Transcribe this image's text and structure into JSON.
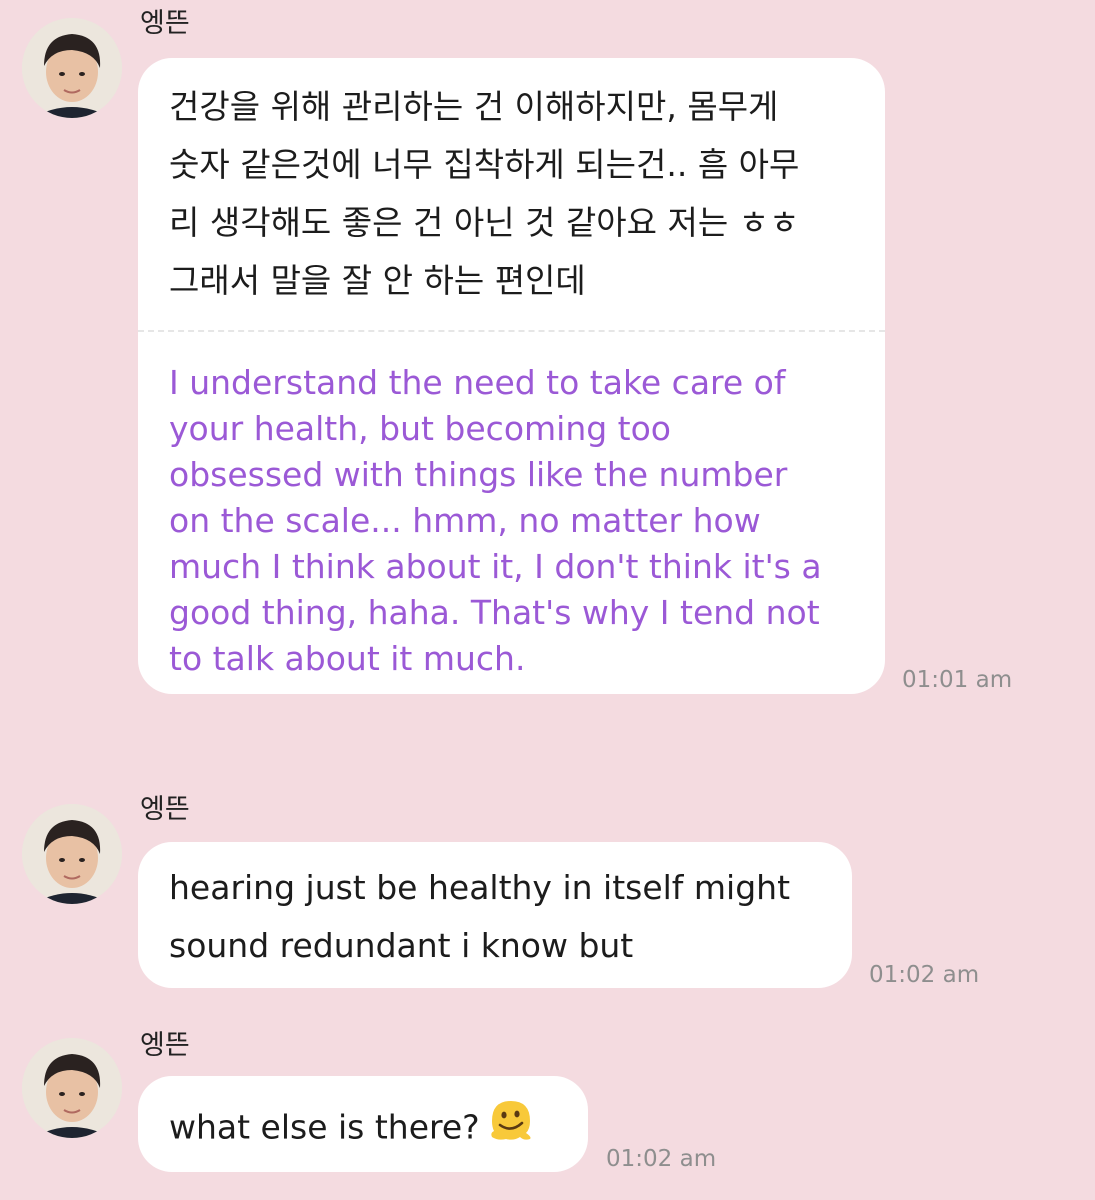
{
  "messages": [
    {
      "sender": "엥뜬",
      "korean": "건강을 위해 관리하는 건 이해하지만, 몸무게\n숫자 같은것에 너무 집착하게 되는건.. 흠 아무\n리 생각해도 좋은 건 아닌 것 같아요 저는 ㅎㅎ\n그래서 말을 잘 안 하는 편인데",
      "translation": "I understand the need to take care of\nyour health, but becoming too\nobsessed with things like the number\non the scale... hmm, no matter how\nmuch I think about it, I don't think it's a\ngood thing, haha. That's why I tend not\nto talk about it much.",
      "time": "01:01 am"
    },
    {
      "sender": "엥뜬",
      "text": "hearing just be healthy in itself might\nsound redundant i know but",
      "time": "01:02 am"
    },
    {
      "sender": "엥뜬",
      "text": "what else is there?",
      "emoji": "melting-face-emoji",
      "time": "01:02 am"
    }
  ],
  "colors": {
    "background": "#f4dbe0",
    "bubble": "#ffffff",
    "translation_text": "#9b59d6",
    "timestamp": "#8e8e8e"
  }
}
